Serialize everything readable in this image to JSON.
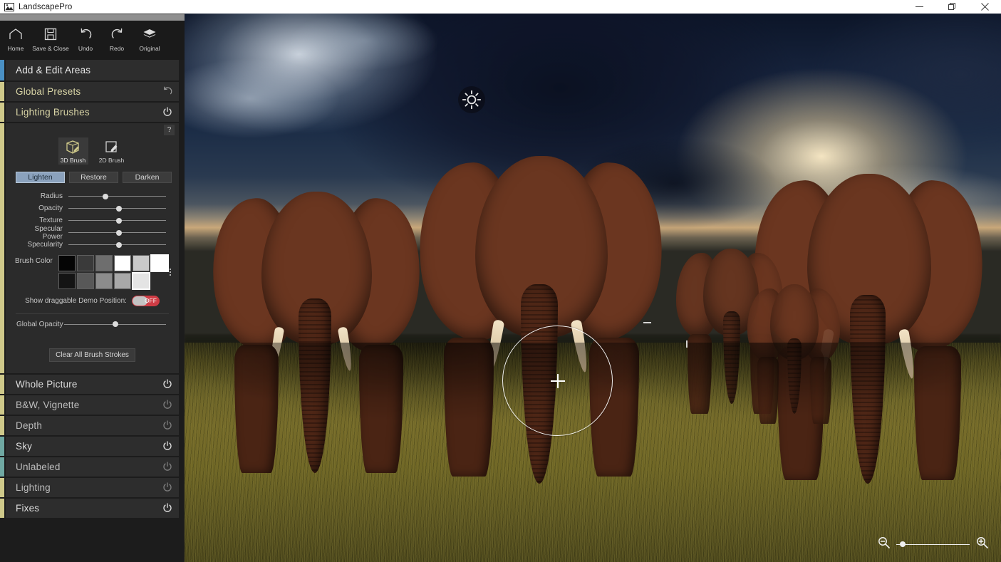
{
  "window": {
    "title": "LandscapePro",
    "app_icon": "landscape-icon",
    "controls": [
      {
        "name": "minimize",
        "glyph": "minimize-icon"
      },
      {
        "name": "restore",
        "glyph": "restore-icon"
      },
      {
        "name": "close",
        "glyph": "close-icon"
      }
    ]
  },
  "toolbar": {
    "items": [
      {
        "label": "Home",
        "icon": "home-icon"
      },
      {
        "label": "Save & Close",
        "icon": "save-icon"
      },
      {
        "label": "Undo",
        "icon": "undo-icon"
      },
      {
        "label": "Redo",
        "icon": "redo-icon"
      },
      {
        "label": "Original",
        "icon": "layers-icon"
      }
    ]
  },
  "colors": {
    "accent_blue": "#4a90c4",
    "accent_khaki": "#cfc98a",
    "accent_teal": "#6fa8a2",
    "toggle_off": "#cf3c45",
    "active_button": "#8ba2bd",
    "panel_bg": "#2b2b2b",
    "sidebar_bg": "#1c1c1c"
  },
  "sidebar": {
    "sections_top": [
      {
        "label": "Add & Edit Areas",
        "accent": "#4a90c4",
        "reset": false,
        "style": "hdr-blue"
      },
      {
        "label": "Global Presets",
        "accent": "#cfc98a",
        "reset": true,
        "reset_icon": "undo-reset-icon",
        "style": "hdr-khaki"
      },
      {
        "label": "Lighting Brushes",
        "accent": "#cfc98a",
        "reset": true,
        "reset_icon": "power-icon",
        "style": "hdr-khaki"
      }
    ],
    "sections_bottom": [
      {
        "label": "Whole Picture",
        "accent": "#cfc98a",
        "active": true,
        "style": "hdr-plain"
      },
      {
        "label": "B&W, Vignette",
        "accent": "#cfc98a",
        "active": false,
        "style": "dim"
      },
      {
        "label": "Depth",
        "accent": "#cfc98a",
        "active": false,
        "style": "dim"
      },
      {
        "label": "Sky",
        "accent": "#6fa8a2",
        "active": true,
        "style": "hdr-plain"
      },
      {
        "label": "Unlabeled",
        "accent": "#6fa8a2",
        "active": false,
        "style": "dim"
      },
      {
        "label": "Lighting",
        "accent": "#cfc98a",
        "active": false,
        "style": "dim"
      },
      {
        "label": "Fixes",
        "accent": "#cfc98a",
        "active": true,
        "style": "hdr-plain"
      }
    ]
  },
  "brush_panel": {
    "help_label": "?",
    "brush_types": [
      {
        "label": "3D Brush",
        "icon": "cube-pencil-icon",
        "selected": true
      },
      {
        "label": "2D Brush",
        "icon": "square-pencil-icon",
        "selected": false
      }
    ],
    "modes": [
      {
        "label": "Lighten",
        "active": true
      },
      {
        "label": "Restore",
        "active": false
      },
      {
        "label": "Darken",
        "active": false
      }
    ],
    "sliders": [
      {
        "label": "Radius",
        "value": 38
      },
      {
        "label": "Opacity",
        "value": 52
      },
      {
        "label": "Texture",
        "value": 52
      },
      {
        "label": "Specular Power",
        "value": 52
      },
      {
        "label": "Specularity",
        "value": 52
      }
    ],
    "brush_color_label": "Brush Color",
    "swatch_rows": [
      [
        {
          "color": "#050505",
          "selected": false
        },
        {
          "color": "#3a3a3a",
          "selected": false
        },
        {
          "color": "#6e6e6e",
          "selected": false
        },
        {
          "color": "#ffffff",
          "selected": false
        },
        {
          "color": "#c9c9c9",
          "selected": false
        },
        {
          "color": "#ffffff",
          "selected": true
        }
      ],
      [
        {
          "color": "#141414",
          "selected": false
        },
        {
          "color": "#585858",
          "selected": false
        },
        {
          "color": "#8c8c8c",
          "selected": false
        },
        {
          "color": "#a8a8a8",
          "selected": false
        },
        {
          "color": "#e4e4e4",
          "selected": true
        }
      ]
    ],
    "demo_position": {
      "label": "Show draggable Demo Position:",
      "state": "OFF"
    },
    "global_opacity": {
      "label": "Global Opacity",
      "value": 50
    },
    "clear_button": "Clear All Brush Strokes"
  },
  "canvas": {
    "sun_marker": "sun-icon",
    "brush_cursor": "brush-circle-cursor",
    "zoom": {
      "out_icon": "zoom-out-icon",
      "in_icon": "zoom-in-icon",
      "value": 5
    }
  }
}
